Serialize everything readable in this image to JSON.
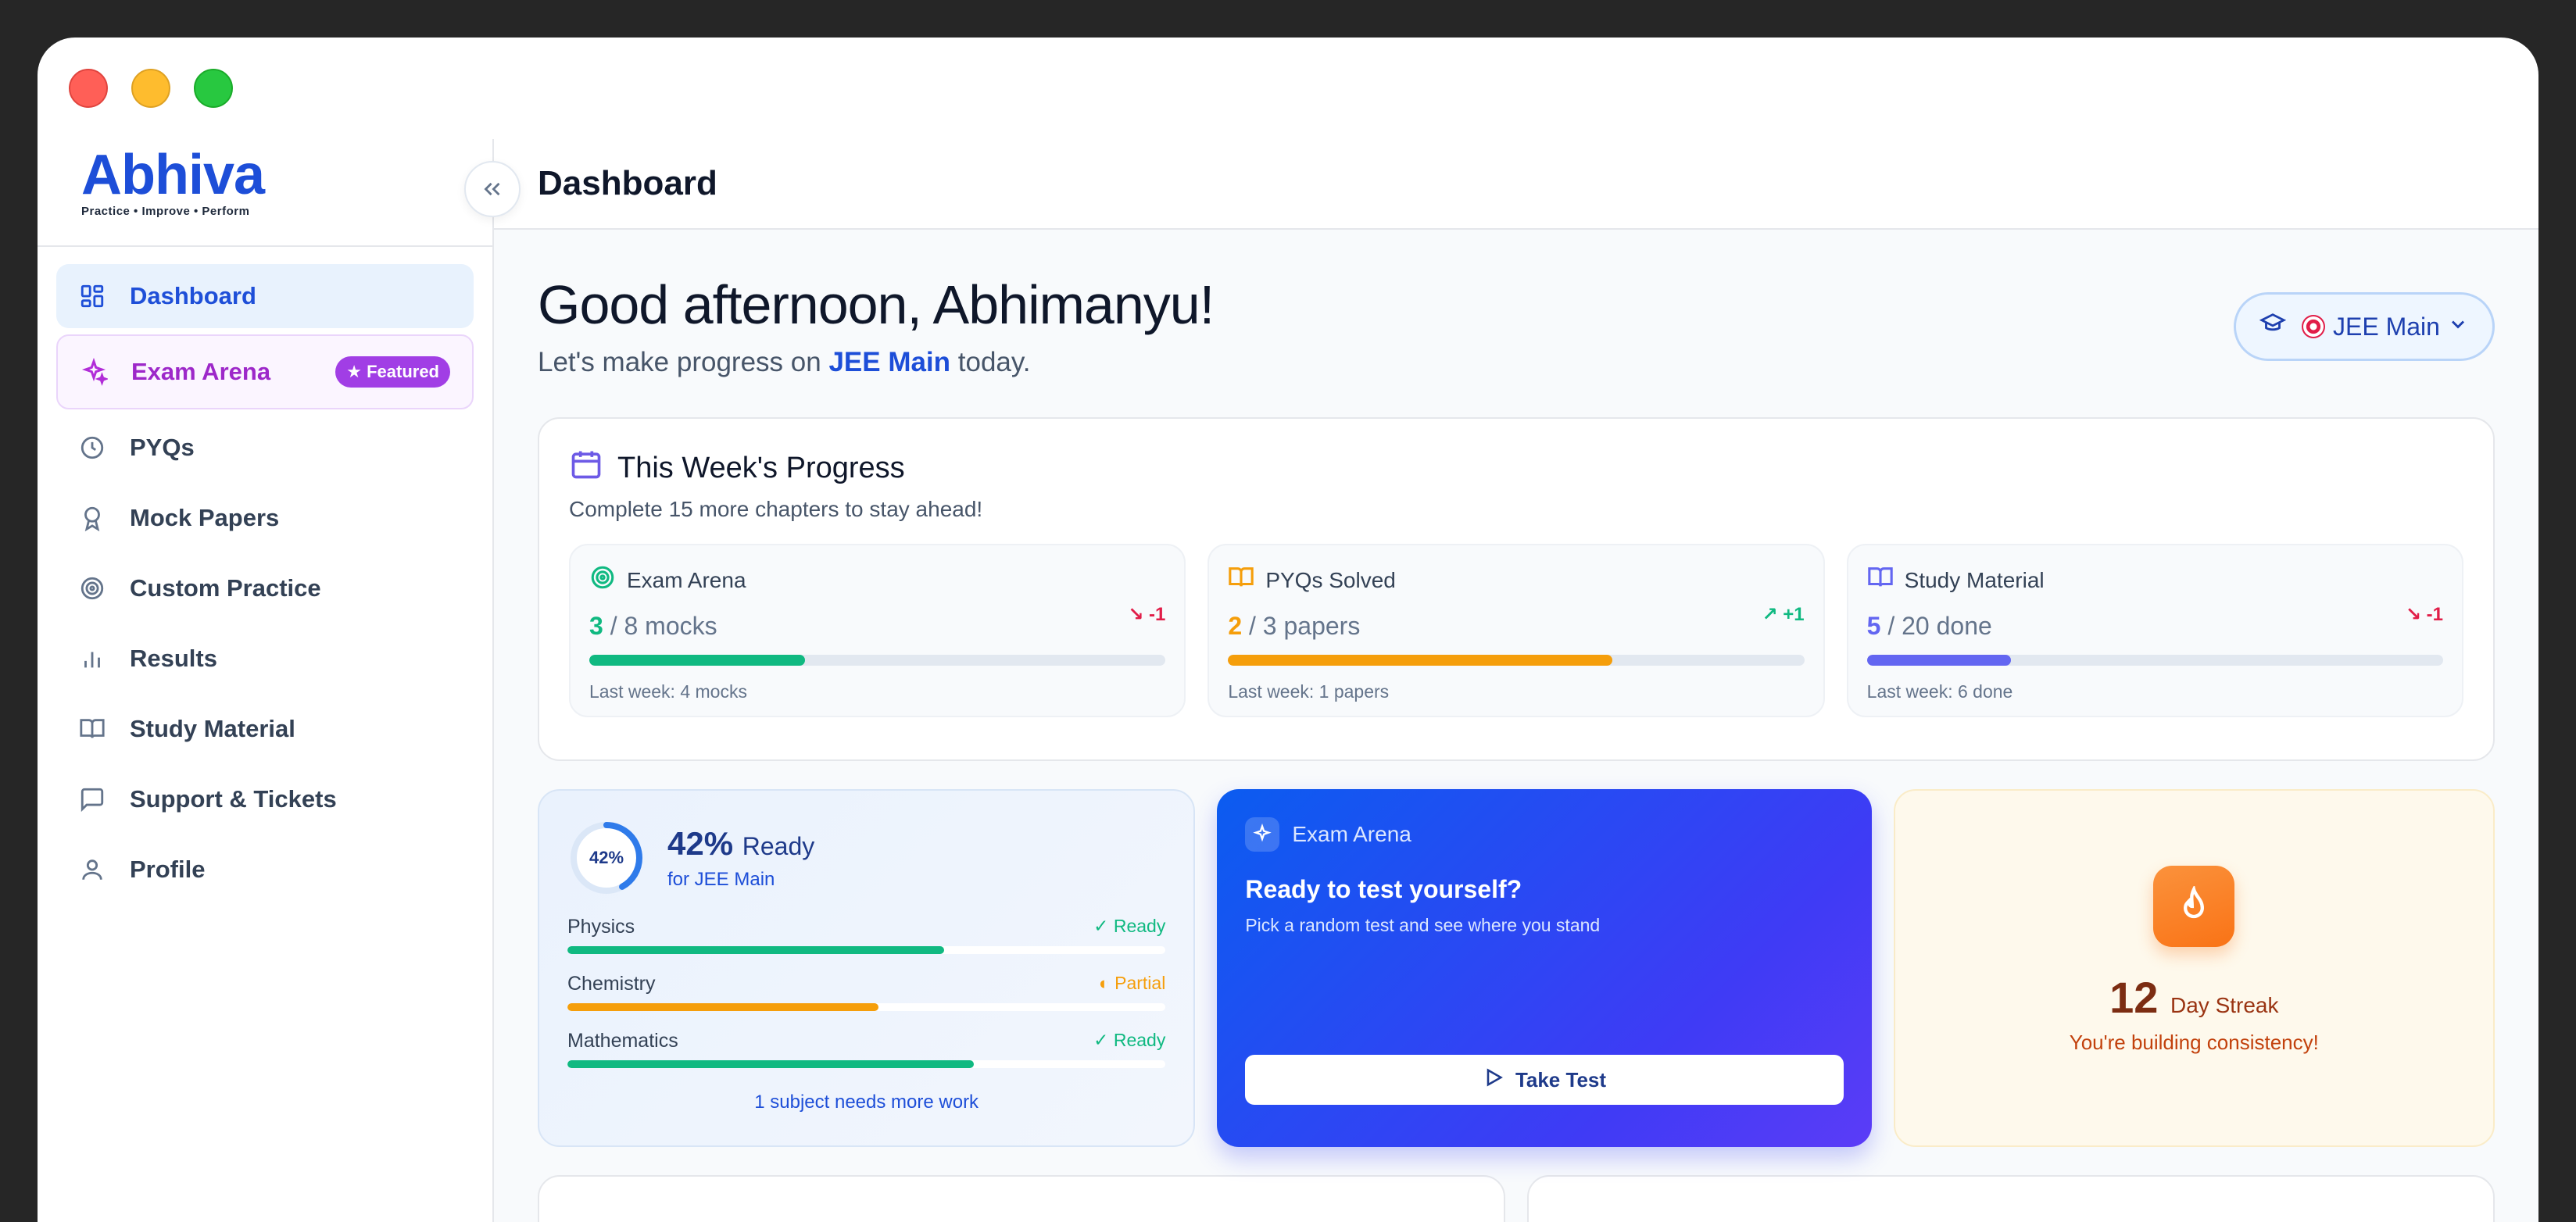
{
  "brand": {
    "name": "Abhiva",
    "tagline": "Practice • Improve • Perform"
  },
  "sidebar": {
    "items": [
      {
        "label": "Dashboard",
        "icon": "grid-icon"
      },
      {
        "label": "Exam Arena",
        "icon": "sparkle-icon",
        "badge": "★ Featured"
      },
      {
        "label": "PYQs",
        "icon": "clock-icon"
      },
      {
        "label": "Mock Papers",
        "icon": "award-icon"
      },
      {
        "label": "Custom Practice",
        "icon": "target-icon"
      },
      {
        "label": "Results",
        "icon": "bar-chart-icon"
      },
      {
        "label": "Study Material",
        "icon": "book-icon"
      },
      {
        "label": "Support & Tickets",
        "icon": "message-icon"
      },
      {
        "label": "Profile",
        "icon": "user-icon"
      }
    ]
  },
  "header": {
    "title": "Dashboard"
  },
  "greeting": {
    "title": "Good afternoon, Abhimanyu!",
    "sub_prefix": "Let's make progress on",
    "sub_exam": "JEE Main",
    "sub_suffix": "today."
  },
  "exam_selector": {
    "value": "JEE Main"
  },
  "weekly": {
    "title": "This Week's Progress",
    "subtitle": "Complete 15 more chapters to stay ahead!",
    "cards": [
      {
        "label": "Exam Arena",
        "done": "3",
        "rest": "/ 8 mocks",
        "delta": "-1",
        "progress": 0.375,
        "last_week": "Last week: 4 mocks",
        "color": "#10b981"
      },
      {
        "label": "PYQs Solved",
        "done": "2",
        "rest": "/ 3 papers",
        "delta": "+1",
        "progress": 0.667,
        "last_week": "Last week: 1 papers",
        "color": "#f59e0b"
      },
      {
        "label": "Study Material",
        "done": "5",
        "rest": "/ 20 done",
        "delta": "-1",
        "progress": 0.25,
        "last_week": "Last week: 6 done",
        "color": "#6366f1"
      }
    ]
  },
  "readiness": {
    "ring_label": "42%",
    "pct": "42%",
    "pct_word": "Ready",
    "for": "for JEE Main",
    "value": 0.42,
    "subjects": [
      {
        "name": "Physics",
        "status": "✓ Ready",
        "progress": 0.63,
        "color": "#10b981"
      },
      {
        "name": "Chemistry",
        "status": "◐ Partial",
        "progress": 0.52,
        "color": "#f59e0b"
      },
      {
        "name": "Mathematics",
        "status": "✓ Ready",
        "progress": 0.68,
        "color": "#10b981"
      }
    ],
    "note": "1 subject needs more work"
  },
  "arena": {
    "label": "Exam Arena",
    "title": "Ready to test yourself?",
    "subtitle": "Pick a random test and see where you stand",
    "button": "Take Test"
  },
  "streak": {
    "count": "12",
    "label": "Day Streak",
    "message": "You're building consistency!"
  }
}
